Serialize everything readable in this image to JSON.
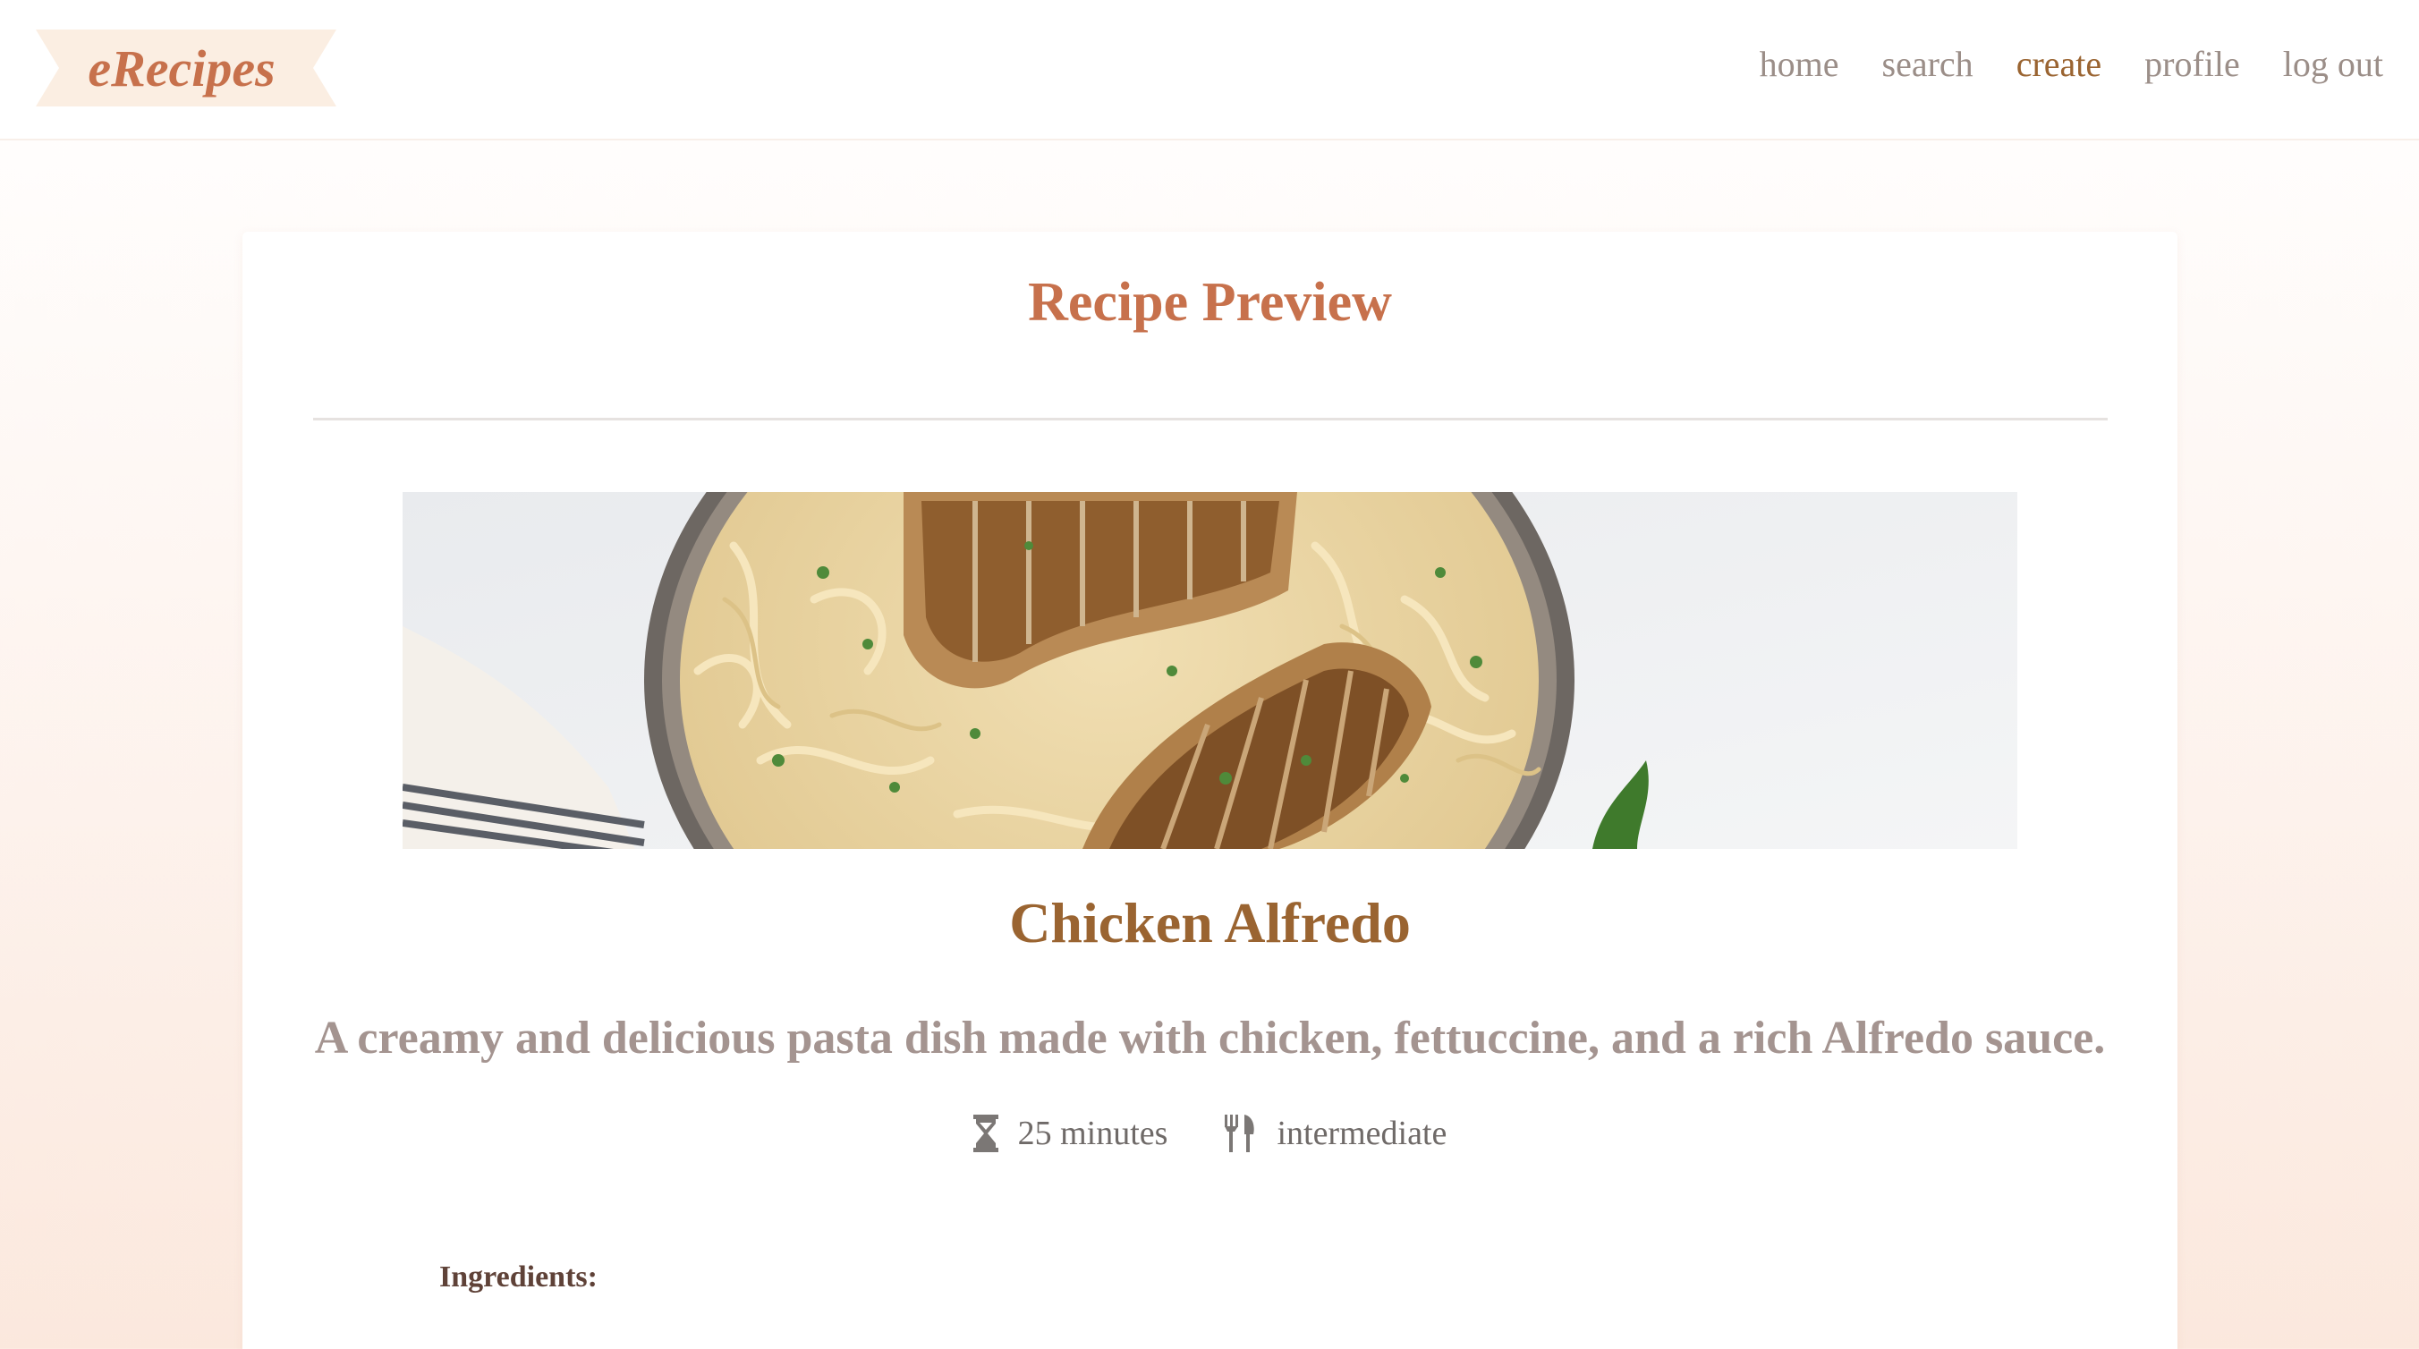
{
  "header": {
    "logo": "eRecipes",
    "nav": [
      {
        "label": "home",
        "active": false
      },
      {
        "label": "search",
        "active": false
      },
      {
        "label": "create",
        "active": true
      },
      {
        "label": "profile",
        "active": false
      },
      {
        "label": "log out",
        "active": false
      }
    ]
  },
  "preview": {
    "title": "Recipe Preview",
    "image": "chicken-alfredo-photo",
    "recipe_name": "Chicken Alfredo",
    "description": "A creamy and delicious pasta dish made with chicken, fettuccine, and a rich Alfredo sauce.",
    "time": {
      "icon": "hourglass-icon",
      "label": "25 minutes"
    },
    "difficulty": {
      "icon": "fork-knife-icon",
      "label": "intermediate"
    },
    "ingredients_label": "Ingredients:"
  },
  "colors": {
    "brand": "#c7714c",
    "accent": "#9a6431",
    "muted": "#9b8e88",
    "logo_ribbon": "#fbeee2"
  }
}
